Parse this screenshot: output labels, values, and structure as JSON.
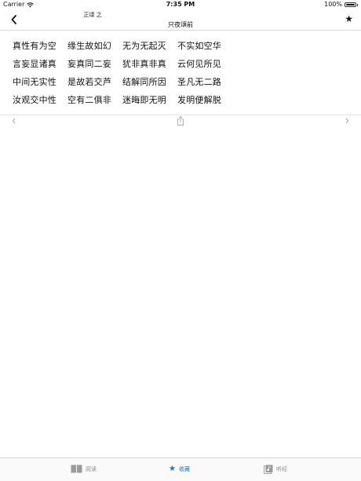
{
  "status_bar": {
    "carrier": "Carrier",
    "time": "7:35 PM",
    "battery_text": "100%",
    "battery_level": 1.0
  },
  "nav": {
    "subtitle": "正頌 之",
    "title": "只夜頌前"
  },
  "verse": {
    "lines": [
      [
        "真性有为空",
        "缘生故如幻",
        "无为无起灭",
        "不实如空华"
      ],
      [
        "言妄显诸真",
        "妄真同二妄",
        "犹非真非真",
        "云何见所见"
      ],
      [
        "中间无实性",
        "是故若交芦",
        "结解同所因",
        "圣凡无二路"
      ],
      [
        "汝观交中性",
        "空有二俱非",
        "迷晦即无明",
        "发明便解脱"
      ]
    ]
  },
  "tabs": [
    {
      "label": "阅读",
      "icon": "book-icon",
      "active": false
    },
    {
      "label": "收藏",
      "icon": "star-icon",
      "active": true
    },
    {
      "label": "听经",
      "icon": "music-icon",
      "active": false
    }
  ],
  "colors": {
    "accent": "#1a6fd8",
    "tab_inactive": "#8a8a8a"
  }
}
